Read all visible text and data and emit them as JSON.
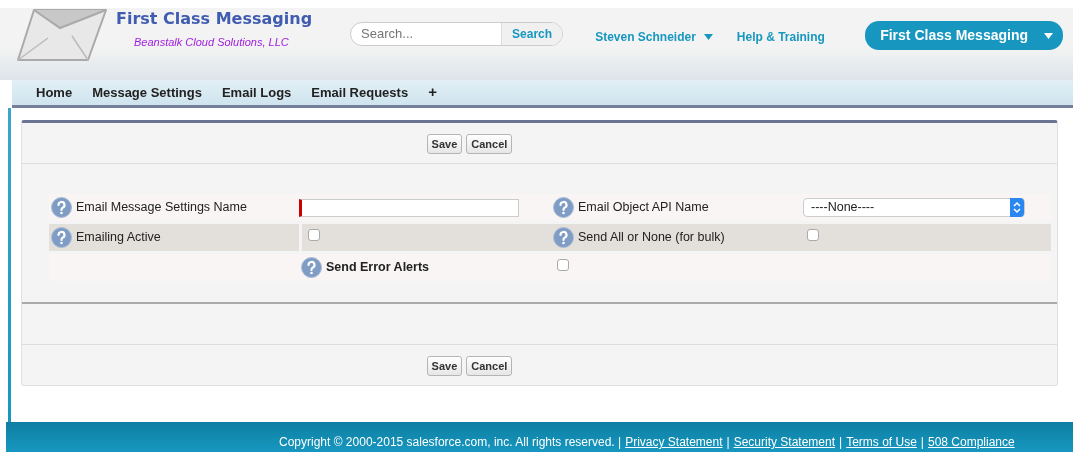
{
  "header": {
    "app_title": "First Class Messaging",
    "subtitle": "Beanstalk Cloud Solutions, LLC",
    "search": {
      "placeholder": "Search...",
      "button": "Search"
    },
    "user_menu": "Steven Schneider",
    "help_link": "Help & Training",
    "app_menu": "First Class Messaging"
  },
  "tabs": [
    "Home",
    "Message Settings",
    "Email Logs",
    "Email Requests",
    "+"
  ],
  "top_buttons": [
    "Save",
    "Cancel"
  ],
  "form_rows": [
    {
      "shaded": false,
      "cells": [
        {
          "kind": "label",
          "text": "Email Message Settings Name",
          "bold": false
        },
        {
          "kind": "text",
          "required": true
        },
        {
          "kind": "label",
          "text": "Email Object API Name",
          "bold": false
        },
        {
          "kind": "select",
          "value": "----None----"
        }
      ]
    },
    {
      "shaded": true,
      "cells": [
        {
          "kind": "label",
          "text": "Emailing Active",
          "bold": false
        },
        {
          "kind": "checkbox",
          "checked": false
        },
        {
          "kind": "label",
          "text": "Send All or None (for bulk)",
          "bold": false
        },
        {
          "kind": "checkbox",
          "checked": false
        }
      ]
    },
    {
      "shaded": false,
      "cells": [
        {
          "kind": "empty"
        },
        {
          "kind": "label",
          "text": "Send Error Alerts",
          "bold": true
        },
        {
          "kind": "checkbox",
          "checked": false
        },
        {
          "kind": "empty"
        }
      ]
    }
  ],
  "bottom_buttons": [
    "Save",
    "Cancel"
  ],
  "footer": {
    "copyright": "Copyright © 2000-2015 salesforce.com, inc. All rights reserved. |",
    "links": [
      "Privacy Statement",
      "Security Statement",
      "Terms of Use",
      "508 Compliance"
    ],
    "separator": "|"
  }
}
